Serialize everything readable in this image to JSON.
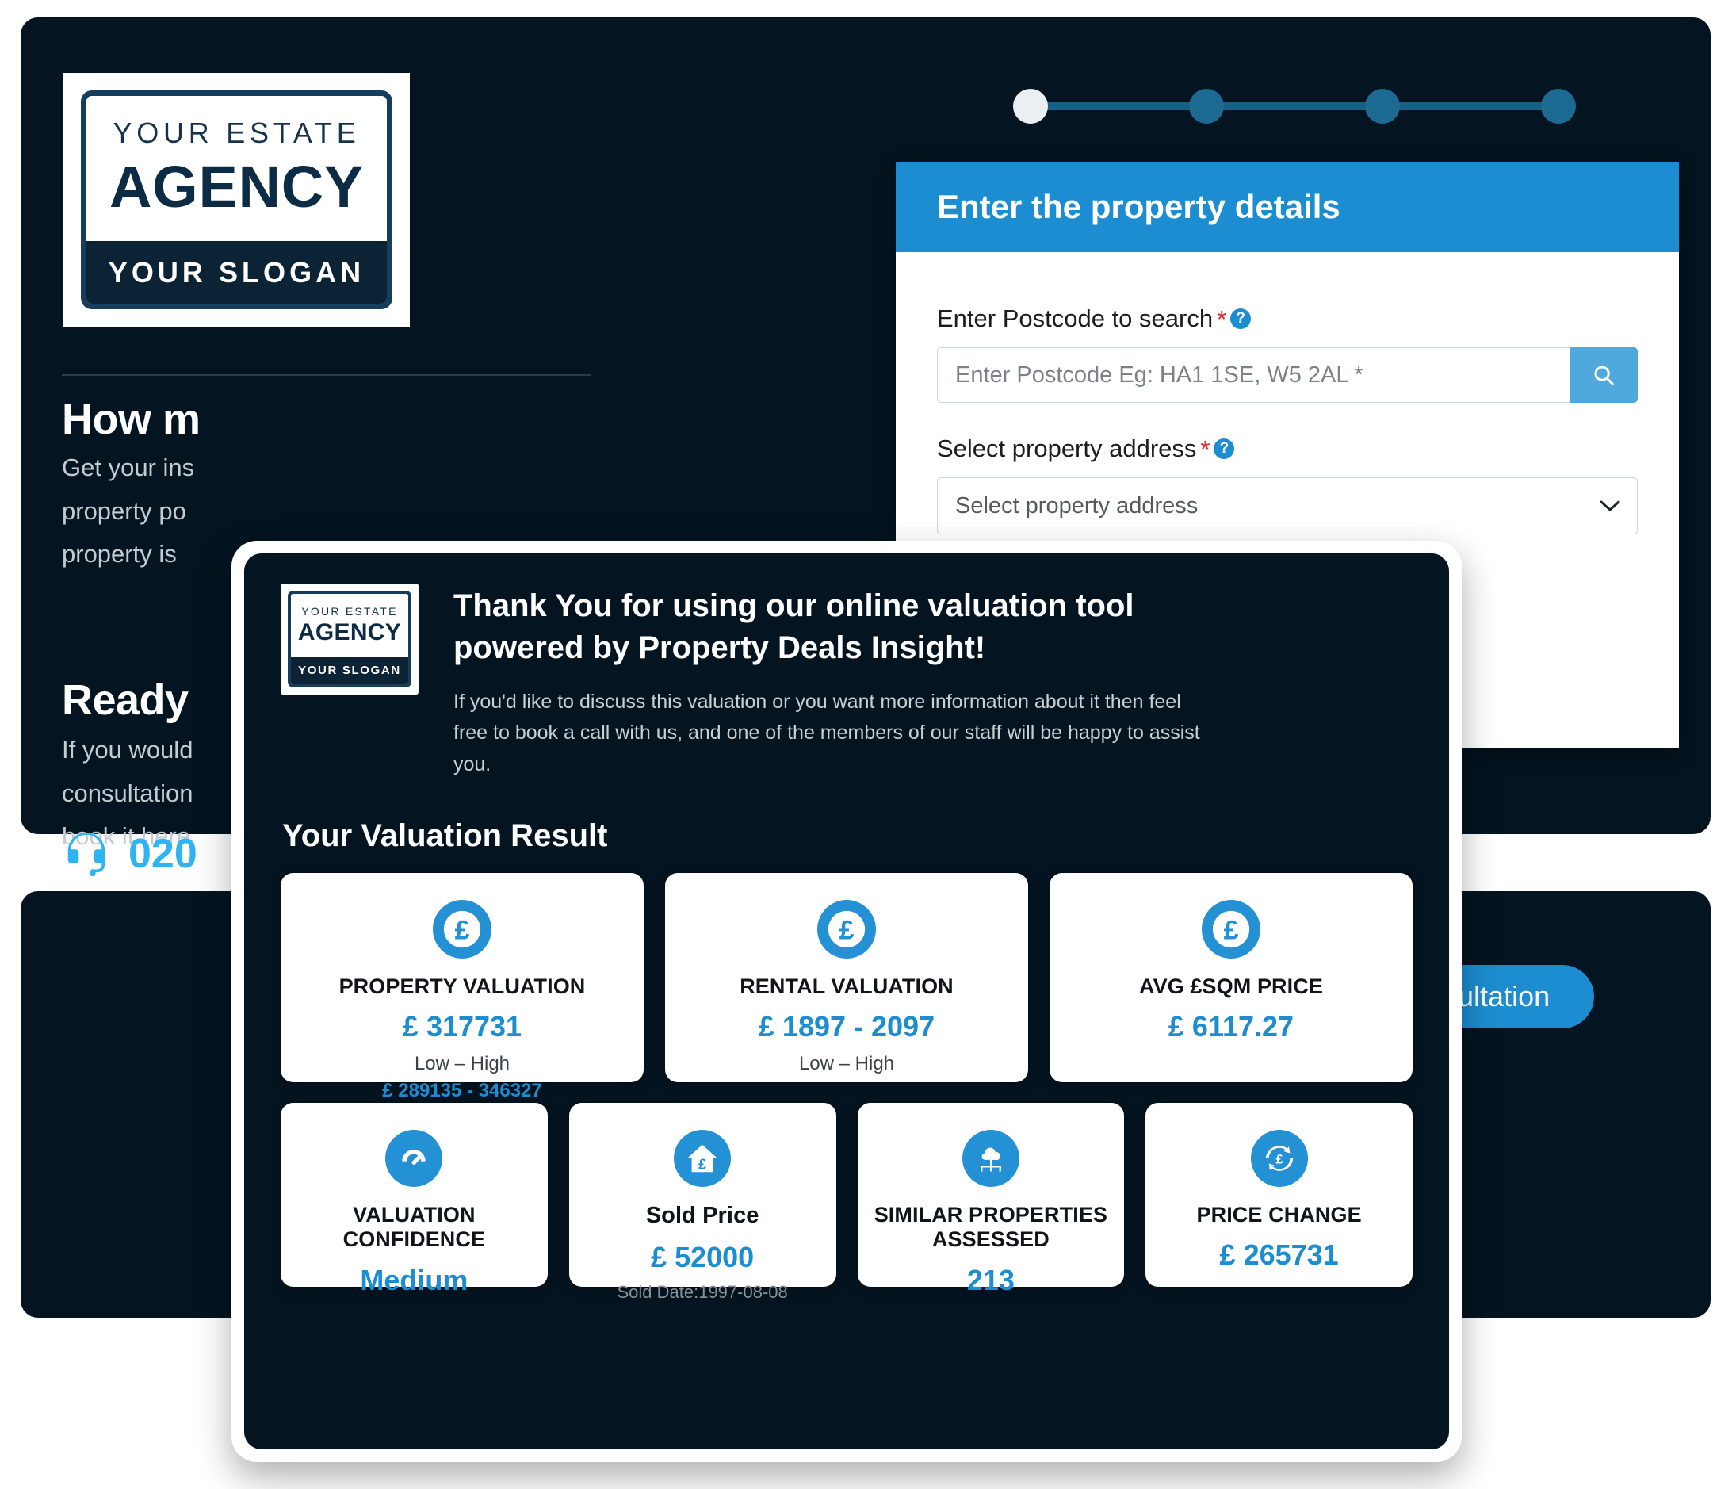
{
  "brand": {
    "line1": "YOUR ESTATE",
    "line2": "AGENCY",
    "slogan": "YOUR SLOGAN"
  },
  "page": {
    "heading_how": "How m",
    "para_how_line1": "Get your ins",
    "para_how_line2": "property po",
    "para_how_line3": "property is ",
    "heading_ready": "Ready",
    "para_ready_line1": "If you would",
    "para_ready_line2": "consultation",
    "para_ready_line3": "book it here",
    "phone": "020",
    "consultation_button": "nsultation"
  },
  "stepper": {
    "steps": [
      "step-1",
      "step-2",
      "step-3",
      "step-4"
    ],
    "active_index": 0,
    "active_color": "#eceff1",
    "inactive_color": "#1b6a92"
  },
  "form": {
    "title": "Enter the property details",
    "postcode_label": "Enter Postcode to search",
    "postcode_required": "*",
    "postcode_placeholder": "Enter Postcode Eg: HA1 1SE, W5 2AL *",
    "postcode_value": "",
    "address_label": "Select property address",
    "address_required": "*",
    "address_selected": "Select property address",
    "help_glyph": "?"
  },
  "modal": {
    "title": "Thank You for using our online valuation tool powered by Property Deals Insight!",
    "subtitle": "If you'd like to discuss this valuation or you want more information about it then feel free to book a call with us, and one of the members of our staff will be happy to assist you.",
    "result_heading": "Your Valuation Result",
    "accent_color": "#1b8dd0",
    "icon_bg_color": "#2491d4",
    "cards_row1": [
      {
        "icon": "pound-coin-icon",
        "title": "PROPERTY VALUATION",
        "value": "£ 317731",
        "sub": "Low – High",
        "range": "£ 289135 - 346327"
      },
      {
        "icon": "pound-coin-icon",
        "title": "RENTAL VALUATION",
        "value": "£ 1897 - 2097",
        "sub": "Low – High",
        "range": ""
      },
      {
        "icon": "pound-coin-icon",
        "title": "AVG £SQM PRICE",
        "value": "£ 6117.27",
        "sub": "",
        "range": ""
      }
    ],
    "cards_row2": [
      {
        "icon": "gauge-icon",
        "title": "VALUATION CONFIDENCE",
        "value": "Medium",
        "note": ""
      },
      {
        "icon": "house-pound-icon",
        "title": "Sold Price",
        "value": "£ 52000",
        "note": "Sold Date:1997-08-08"
      },
      {
        "icon": "similar-properties-icon",
        "title": "SIMILAR PROPERTIES ASSESSED",
        "value": "213",
        "note": ""
      },
      {
        "icon": "price-change-icon",
        "title": "PRICE CHANGE",
        "value": "£ 265731",
        "note": ""
      }
    ]
  }
}
